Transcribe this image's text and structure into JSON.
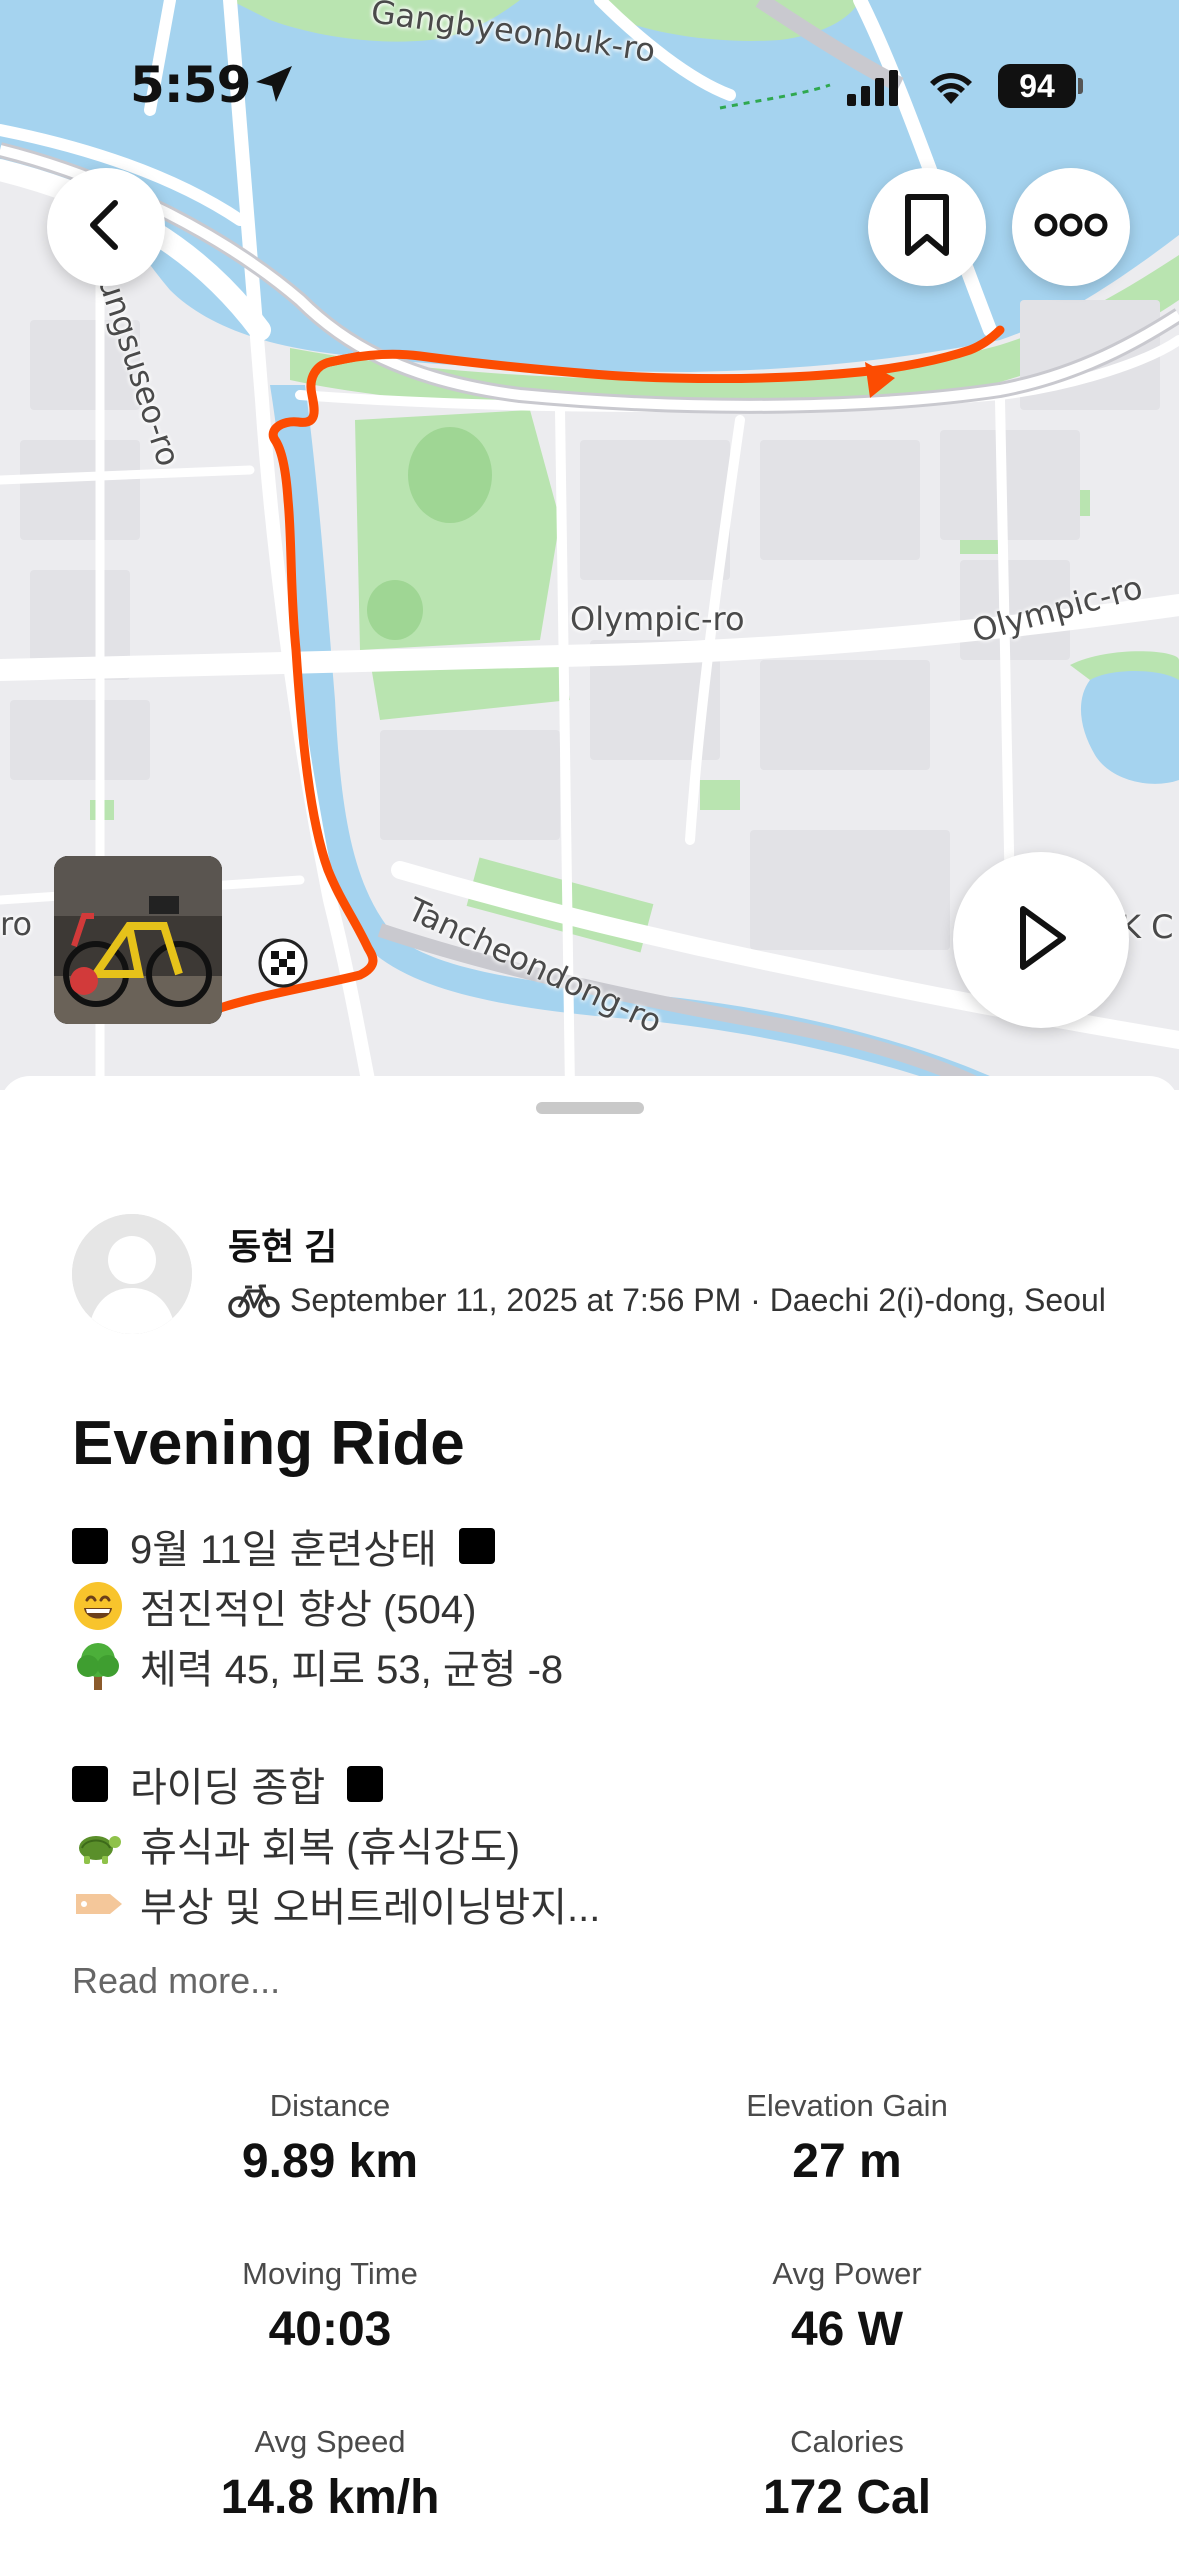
{
  "status_bar": {
    "time": "5:59",
    "battery": "94"
  },
  "map": {
    "labels": {
      "gangbyeonbuk": "Gangbyeonbuk-ro",
      "bungsuseo": "Bungsuseo-ro",
      "olympic1": "Olympic-ro",
      "olympic2": "Olympic-ro",
      "tancheondong": "Tancheondong-ro",
      "ro_edge": "ro",
      "kc_edge": "K C"
    }
  },
  "activity": {
    "athlete_name": "동현 김",
    "meta": "September 11, 2025 at 7:56 PM · Daechi 2(i)-dong, Seoul",
    "title": "Evening Ride",
    "description": {
      "line1": "9월 11일 훈련상태",
      "line2": "점진적인 향상 (504)",
      "line3": "체력 45, 피로 53, 균형 -8",
      "line4": "라이딩 종합",
      "line5": "휴식과 회복 (휴식강도)",
      "line6": "부상 및 오버트레이닝방지..."
    },
    "read_more": "Read more..."
  },
  "stats": {
    "distance": {
      "label": "Distance",
      "value": "9.89 km"
    },
    "elevation": {
      "label": "Elevation Gain",
      "value": "27 m"
    },
    "moving_time": {
      "label": "Moving Time",
      "value": "40:03"
    },
    "avg_power": {
      "label": "Avg Power",
      "value": "46 W"
    },
    "avg_speed": {
      "label": "Avg Speed",
      "value": "14.8 km/h"
    },
    "calories": {
      "label": "Calories",
      "value": "172 Cal"
    }
  },
  "colors": {
    "route": "#fc4c02",
    "water": "#a5d3ef",
    "park": "#b9e4b0",
    "land": "#ececef"
  },
  "icons": [
    "location-arrow-icon",
    "cellular-signal-icon",
    "wifi-icon",
    "battery-icon",
    "back-chevron-icon",
    "bookmark-icon",
    "more-icon",
    "play-icon",
    "finish-flag-icon",
    "bike-icon"
  ]
}
